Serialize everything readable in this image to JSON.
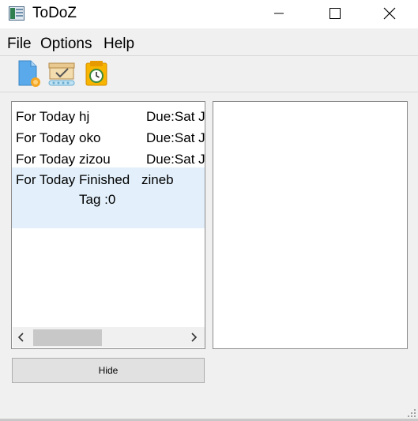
{
  "window": {
    "title": "ToDoZ"
  },
  "menu": {
    "file": "File",
    "options": "Options",
    "help": "Help"
  },
  "toolbar": {
    "icons": [
      "new-task-icon",
      "mark-done-icon",
      "postpone-icon"
    ]
  },
  "tasks": [
    {
      "category": "For Today",
      "name": "hj",
      "due": "Due:Sat Ja"
    },
    {
      "category": "For Today",
      "name": "oko",
      "due": "Due:Sat Ja"
    },
    {
      "category": "For Today",
      "name": "zizou",
      "due": "Due:Sat Ja"
    },
    {
      "category": "For Today",
      "status": "Finished",
      "name": "zineb",
      "tag": "Tag :0"
    }
  ],
  "hide_button": "Hide",
  "colors": {
    "selected_row": "#e3f0fb",
    "background": "#f0f0f0",
    "border": "#8c8c8c"
  }
}
